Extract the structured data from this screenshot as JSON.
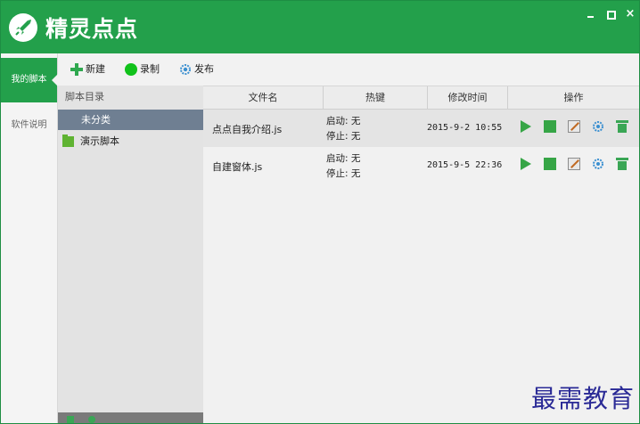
{
  "window": {
    "title": "精灵点点",
    "close_label": "×",
    "accent_color": "#23a04b"
  },
  "nav": {
    "items": [
      {
        "label": "我的脚本",
        "active": true
      },
      {
        "label": "软件说明",
        "active": false
      }
    ]
  },
  "toolbar": {
    "new_label": "新建",
    "record_label": "录制",
    "publish_label": "发布"
  },
  "directory": {
    "header": "脚本目录",
    "category": "未分类",
    "folder": "演示脚本"
  },
  "table": {
    "columns": [
      "文件名",
      "热键",
      "修改时间",
      "操作"
    ],
    "rows": [
      {
        "name": "点点自我介绍.js",
        "hk_start": "启动: 无",
        "hk_stop": "停止: 无",
        "time": "2015-9-2 10:55"
      },
      {
        "name": "自建窗体.js",
        "hk_start": "启动: 无",
        "hk_stop": "停止: 无",
        "time": "2015-9-5 22:36"
      }
    ],
    "action_icons": [
      "play-icon",
      "stop-icon",
      "edit-icon",
      "settings-icon",
      "delete-icon"
    ]
  },
  "watermark": "最需教育"
}
